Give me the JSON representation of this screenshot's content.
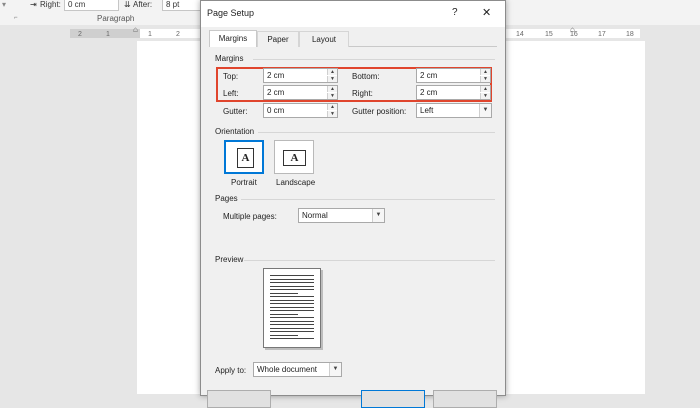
{
  "ribbon": {
    "right_label": "Right:",
    "right_value": "0 cm",
    "after_label": "After:",
    "after_value": "8 pt",
    "group_label": "Paragraph"
  },
  "ruler": {
    "ticks": [
      "2",
      "1",
      "1",
      "2",
      "14",
      "15",
      "16",
      "17",
      "18"
    ]
  },
  "dialog": {
    "title": "Page Setup",
    "help": "?",
    "close": "✕",
    "tabs": [
      "Margins",
      "Paper",
      "Layout"
    ],
    "margins": {
      "section": "Margins",
      "top_label": "Top:",
      "top_value": "2 cm",
      "bottom_label": "Bottom:",
      "bottom_value": "2 cm",
      "left_label": "Left:",
      "left_value": "2 cm",
      "right_label": "Right:",
      "right_value": "2 cm",
      "gutter_label": "Gutter:",
      "gutter_value": "0 cm",
      "gutter_pos_label": "Gutter position:",
      "gutter_pos_value": "Left"
    },
    "orientation": {
      "section": "Orientation",
      "portrait": "Portrait",
      "landscape": "Landscape",
      "icon_letter": "A"
    },
    "pages": {
      "section": "Pages",
      "multiple_label": "Multiple pages:",
      "multiple_value": "Normal"
    },
    "preview": {
      "section": "Preview"
    },
    "apply": {
      "label": "Apply to:",
      "value": "Whole document"
    }
  },
  "colors": {
    "highlight": "#e0452d",
    "selected_border": "#0078d7"
  }
}
